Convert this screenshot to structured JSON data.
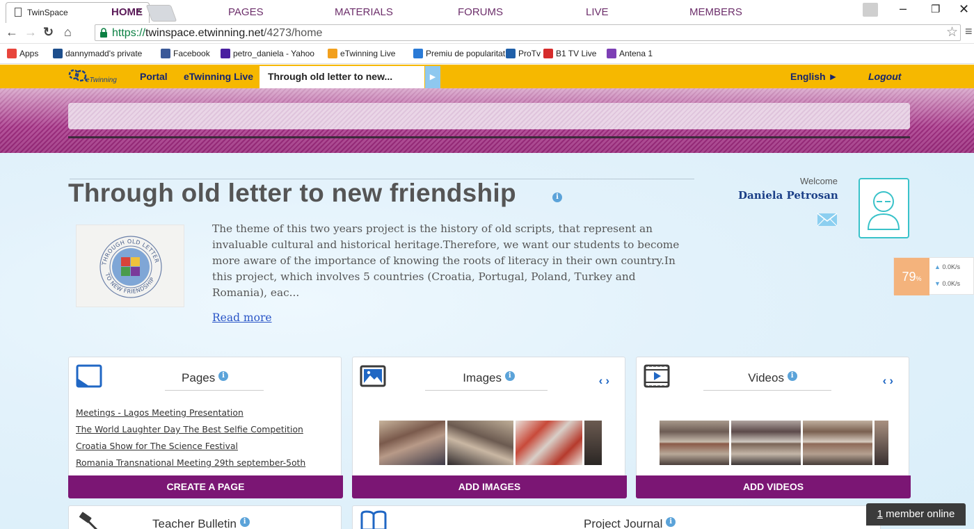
{
  "browser": {
    "tab_title": "TwinSpace",
    "url_secure": "https://",
    "url_host": "twinspace.etwinning.net",
    "url_path": "/4273/home",
    "bookmarks": [
      {
        "label": "Apps",
        "color": "#e8453c"
      },
      {
        "label": "dannymadd's private",
        "color": "#1d4e8c"
      },
      {
        "label": "Facebook",
        "color": "#3b5998"
      },
      {
        "label": "petro_daniela - Yahoo",
        "color": "#4a1fa0"
      },
      {
        "label": "eTwinning Live",
        "color": "#f2a01e"
      },
      {
        "label": "Premiu de popularitat",
        "color": "#2a7ad6"
      },
      {
        "label": "ProTv",
        "color": "#1f5fa8"
      },
      {
        "label": "B1 TV Live",
        "color": "#d62b2b"
      },
      {
        "label": "Antena 1",
        "color": "#7d3fb5"
      }
    ]
  },
  "etwinning": {
    "logo_text": "eTwinning",
    "portal": "Portal",
    "live": "eTwinning Live",
    "active_tab": "Through old letter to new...",
    "language": "English ►",
    "logout": "Logout",
    "accent": "#f6b800"
  },
  "nav": {
    "items": [
      "HOME",
      "PAGES",
      "MATERIALS",
      "FORUMS",
      "LIVE",
      "MEMBERS"
    ],
    "active": "HOME"
  },
  "project": {
    "title": "Through old letter to new friendship",
    "description": "The theme of this two years project is the history of old scripts, that represent an invaluable cultural and historical heritage.Therefore, we want our students to become more aware of the importance of knowing the roots of literacy in their own country.In this project, which involves 5 countries (Croatia, Portugal, Poland, Turkey and Romania), eac...",
    "read_more": "Read more",
    "logo_text_top": "THROUGH OLD LETTER",
    "logo_text_bottom": "TO NEW FRIENDSHIP"
  },
  "user": {
    "welcome": "Welcome",
    "name": "Daniela Petrosan"
  },
  "speed_widget": {
    "percent": "79",
    "percent_sign": "%",
    "upload": "0.0K/s",
    "download": "0.0K/s"
  },
  "cards": {
    "pages": {
      "title": "Pages",
      "links": [
        "Meetings - Lagos Meeting Presentation",
        "The World Laughter Day The Best Selfie Competition",
        "Croatia Show for The Science Festival",
        "Romania Transnational Meeting 29th september-5oth"
      ],
      "button": "CREATE A PAGE"
    },
    "images": {
      "title": "Images",
      "button": "ADD IMAGES"
    },
    "videos": {
      "title": "Videos",
      "button": "ADD VIDEOS"
    },
    "bulletin": {
      "title": "Teacher Bulletin"
    },
    "journal": {
      "title": "Project Journal"
    }
  },
  "online": {
    "count": "1",
    "label": " member online"
  },
  "colors": {
    "purple": "#7b1674",
    "link_blue": "#2067c4",
    "avatar_border": "#39c2c9"
  }
}
